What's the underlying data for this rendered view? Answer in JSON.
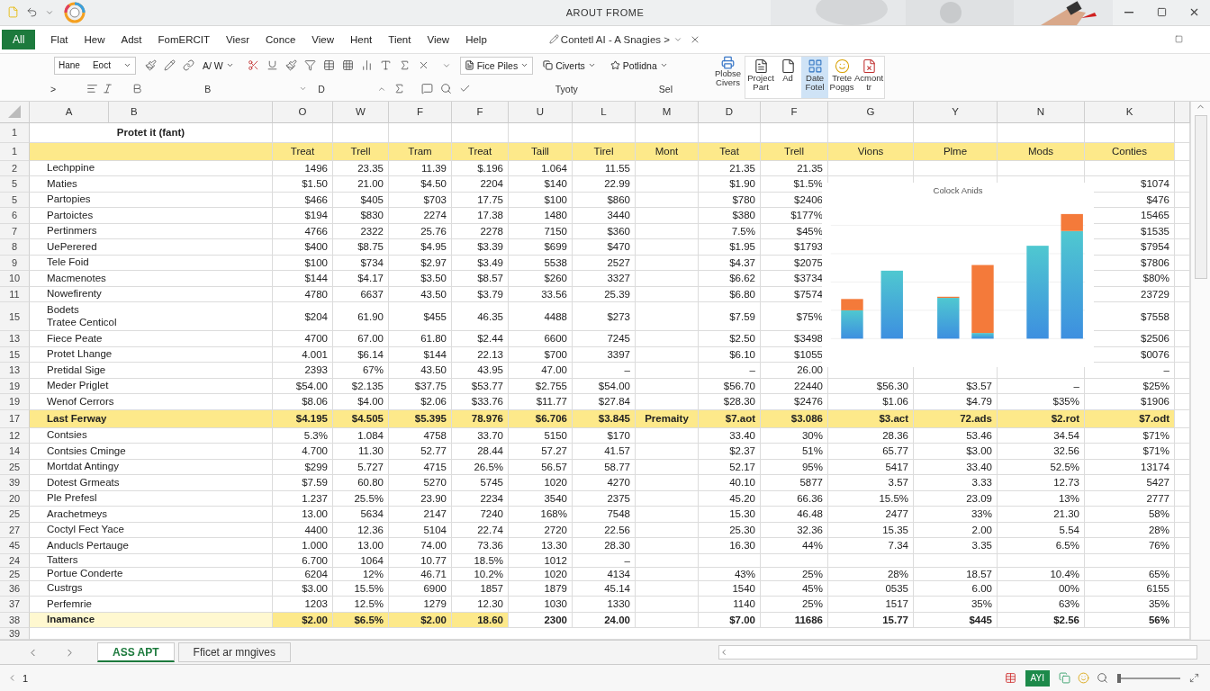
{
  "window": {
    "title": "AROUT FROME"
  },
  "menu": {
    "file_button": "All",
    "tabs": [
      "Flat",
      "Hew",
      "Adst",
      "FomERCIT",
      "Viesr",
      "Conce",
      "View",
      "Hent",
      "Tient",
      "View",
      "Help"
    ],
    "document": "Contetl AI - A Snagies >"
  },
  "ribbon": {
    "font": "Hane",
    "size": "Eoct",
    "style": "A/ W",
    "dropdowns": [
      "Fice Piles",
      "Civerts",
      "Potlidna"
    ],
    "side_button": [
      "Plobse",
      "Civers"
    ],
    "large_buttons": [
      {
        "lines": [
          "Project",
          "Part"
        ],
        "selected": false
      },
      {
        "lines": [
          "Ad"
        ],
        "selected": false
      },
      {
        "lines": [
          "Date",
          "Fotel"
        ],
        "selected": true
      },
      {
        "lines": [
          "Trete",
          "Poggs"
        ],
        "selected": false
      },
      {
        "lines": [
          "Acmont",
          "tr"
        ],
        "selected": false
      }
    ],
    "row2": [
      ">",
      "B",
      "D"
    ],
    "group_label": "Tyoty",
    "group_label_2": "Sel"
  },
  "columns": [
    "A",
    "B",
    "O",
    "W",
    "F",
    "F",
    "U",
    "L",
    "M",
    "D",
    "F",
    "G",
    "Y",
    "N",
    "K"
  ],
  "title_row": {
    "number": "1",
    "text": "Protet it (fant)"
  },
  "rows": [
    {
      "number": "1",
      "kind": "header",
      "cells": [
        "Treat",
        "Trell",
        "Tram",
        "Treat",
        "Taill",
        "Tirel",
        "Mont",
        "Teat",
        "Trell",
        "Vions",
        "Plme",
        "Mods",
        "Conties"
      ]
    },
    {
      "number": "2",
      "kind": "normal",
      "label": "Lechppine",
      "cells": [
        "1496",
        "23.35",
        "11.39",
        "$.196",
        "1.064",
        "11.55",
        null,
        "21.35",
        "21.35",
        null,
        null,
        null,
        null
      ]
    },
    {
      "number": "5",
      "kind": "normal",
      "label": "Maties",
      "cells": [
        "$1.50",
        "21.00",
        "$4.50",
        "2204",
        "$140",
        "22.99",
        null,
        "$1.90",
        "$1.5%",
        null,
        null,
        null,
        "$1074"
      ]
    },
    {
      "number": "5",
      "kind": "normal",
      "label": "Partopies",
      "cells": [
        "$466",
        "$405",
        "$703",
        "17.75",
        "$100",
        "$860",
        null,
        "$780",
        "$2406",
        null,
        null,
        null,
        "$476"
      ]
    },
    {
      "number": "6",
      "kind": "normal",
      "label": "Partoictes",
      "cells": [
        "$194",
        "$830",
        "2274",
        "17.38",
        "1480",
        "3440",
        null,
        "$380",
        "$177%",
        null,
        null,
        null,
        "15465"
      ]
    },
    {
      "number": "7",
      "kind": "normal",
      "label": "Pertinmers",
      "cells": [
        "4766",
        "2322",
        "25.76",
        "2278",
        "7150",
        "$360",
        null,
        "7.5%",
        "$45%",
        null,
        null,
        null,
        "$1535"
      ]
    },
    {
      "number": "8",
      "kind": "normal",
      "label": "UePerered",
      "cells": [
        "$400",
        "$8.75",
        "$4.95",
        "$3.39",
        "$699",
        "$470",
        null,
        "$1.95",
        "$1793",
        null,
        null,
        null,
        "$7954"
      ]
    },
    {
      "number": "9",
      "kind": "normal",
      "label": "Tele Foid",
      "cells": [
        "$100",
        "$734",
        "$2.97",
        "$3.49",
        "5538",
        "2527",
        null,
        "$4.37",
        "$2075",
        null,
        null,
        null,
        "$7806"
      ]
    },
    {
      "number": "10",
      "kind": "normal",
      "label": "Macmenotes",
      "cells": [
        "$144",
        "$4.17",
        "$3.50",
        "$8.57",
        "$260",
        "3327",
        null,
        "$6.62",
        "$3734",
        null,
        null,
        null,
        "$80%"
      ]
    },
    {
      "number": "11",
      "kind": "normal",
      "label": "Nowefirenty",
      "cells": [
        "4780",
        "6637",
        "43.50",
        "$3.79",
        "33.56",
        "25.39",
        null,
        "$6.80",
        "$7574",
        null,
        null,
        null,
        "23729"
      ]
    },
    {
      "number": "15",
      "kind": "normal",
      "note": "Bodets",
      "label": "Tratee Centicol",
      "cells": [
        "$204",
        "61.90",
        "$455",
        "46.35",
        "4488",
        "$273",
        null,
        "$7.59",
        "$75%",
        null,
        null,
        null,
        "$7558"
      ]
    },
    {
      "number": "13",
      "kind": "normal",
      "label": "Fiece Peate",
      "cells": [
        "4700",
        "67.00",
        "61.80",
        "$2.44",
        "6600",
        "7245",
        null,
        "$2.50",
        "$3498",
        null,
        null,
        null,
        "$2506"
      ]
    },
    {
      "number": "15",
      "kind": "normal",
      "label": "Protet Lhange",
      "cells": [
        "4.001",
        "$6.14",
        "$144",
        "22.13",
        "$700",
        "3397",
        null,
        "$6.10",
        "$1055",
        null,
        null,
        null,
        "$0076"
      ]
    },
    {
      "number": "13",
      "kind": "normal",
      "label": "Pretidal Sige",
      "cells": [
        "2393",
        "67%",
        "43.50",
        "43.95",
        "47.00",
        "–",
        null,
        "–",
        "26.00",
        null,
        null,
        null,
        "–"
      ]
    },
    {
      "number": "19",
      "kind": "normal",
      "label": "Meder Priglet",
      "cells": [
        "$54.00",
        "$2.135",
        "$37.75",
        "$53.77",
        "$2.755",
        "$54.00",
        null,
        "$56.70",
        "22440",
        "$56.30",
        "$3.57",
        "–",
        "$25%"
      ]
    },
    {
      "number": "19",
      "kind": "normal",
      "label": "Wenof Cerrors",
      "cells": [
        "$8.06",
        "$4.00",
        "$2.06",
        "$33.76",
        "$11.77",
        "$27.84",
        null,
        "$28.30",
        "$2476",
        "$1.06",
        "$4.79",
        "$35%",
        "$1906"
      ]
    },
    {
      "number": "17",
      "kind": "total",
      "label": "Last Ferway",
      "cells": [
        "$4.195",
        "$4.505",
        "$5.395",
        "78.976",
        "$6.706",
        "$3.845",
        "Premaity",
        "$7.aot",
        "$3.086",
        "$3.act",
        "72.ads",
        "$2.rot",
        "$7.odt"
      ]
    },
    {
      "number": "12",
      "kind": "normal",
      "label": "Contsies",
      "cells": [
        "5.3%",
        "1.084",
        "4758",
        "33.70",
        "5150",
        "$170",
        null,
        "33.40",
        "30%",
        "28.36",
        "53.46",
        "34.54",
        "$71%"
      ]
    },
    {
      "number": "14",
      "kind": "normal",
      "label": "Contsies Cminge",
      "cells": [
        "4.700",
        "11.30",
        "52.77",
        "28.44",
        "57.27",
        "41.57",
        null,
        "$2.37",
        "51%",
        "65.77",
        "$3.00",
        "32.56",
        "$71%"
      ]
    },
    {
      "number": "25",
      "kind": "normal",
      "label": "Mortdat Antingy",
      "cells": [
        "$299",
        "5.727",
        "4715",
        "26.5%",
        "56.57",
        "58.77",
        null,
        "52.17",
        "95%",
        "5417",
        "33.40",
        "52.5%",
        "13174"
      ]
    },
    {
      "number": "39",
      "kind": "normal",
      "label": "Dotest Grmeats",
      "cells": [
        "$7.59",
        "60.80",
        "5270",
        "5745",
        "1020",
        "4270",
        null,
        "40.10",
        "5877",
        "3.57",
        "3.33",
        "12.73",
        "5427"
      ]
    },
    {
      "number": "20",
      "kind": "normal",
      "label": "Ple Prefesl",
      "cells": [
        "1.237",
        "25.5%",
        "23.90",
        "2234",
        "3540",
        "2375",
        null,
        "45.20",
        "66.36",
        "15.5%",
        "23.09",
        "13%",
        "2777"
      ]
    },
    {
      "number": "25",
      "kind": "normal",
      "label": "Arachetmeys",
      "cells": [
        "13.00",
        "5634",
        "2147",
        "7240",
        "168%",
        "7548",
        null,
        "15.30",
        "46.48",
        "2477",
        "33%",
        "21.30",
        "58%"
      ]
    },
    {
      "number": "27",
      "kind": "normal",
      "label": "Coctyl Fect Yace",
      "cells": [
        "4400",
        "12.36",
        "5104",
        "22.74",
        "2720",
        "22.56",
        null,
        "25.30",
        "32.36",
        "15.35",
        "2.00",
        "5.54",
        "28%"
      ]
    },
    {
      "number": "45",
      "kind": "normal",
      "label": "Anducls Pertauge",
      "cells": [
        "1.000",
        "13.00",
        "74.00",
        "73.36",
        "13.30",
        "28.30",
        null,
        "16.30",
        "44%",
        "7.34",
        "3.35",
        "6.5%",
        "76%"
      ]
    },
    {
      "number": "24",
      "kind": "compact",
      "label": "Tatters",
      "cells": [
        "6.700",
        "1064",
        "10.77",
        "18.5%",
        "1012",
        "–",
        null,
        null,
        null,
        null,
        null,
        null,
        null
      ]
    },
    {
      "number": "25",
      "kind": "compact",
      "label": "Portue Conderte",
      "cells": [
        "6204",
        "12%",
        "46.71",
        "10.2%",
        "1020",
        "4134",
        null,
        "43%",
        "25%",
        "28%",
        "18.57",
        "10.4%",
        "65%"
      ]
    },
    {
      "number": "36",
      "kind": "normal",
      "label": "Custrgs",
      "cells": [
        "$3.00",
        "15.5%",
        "6900",
        "1857",
        "1879",
        "45.14",
        null,
        "1540",
        "45%",
        "0535",
        "6.00",
        "00%",
        "6155"
      ]
    },
    {
      "number": "37",
      "kind": "normal",
      "label": "Perfemrie",
      "cells": [
        "1203",
        "12.5%",
        "1279",
        "12.30",
        "1030",
        "1330",
        null,
        "1140",
        "25%",
        "1517",
        "35%",
        "63%",
        "35%"
      ]
    },
    {
      "number": "38",
      "kind": "partial",
      "label": "Inamance",
      "cells": [
        "$2.00",
        "$6.5%",
        "$2.00",
        "18.60",
        "2300",
        "24.00",
        null,
        "$7.00",
        "11686",
        "15.77",
        "$445",
        "$2.56",
        "56%"
      ]
    },
    {
      "number": "39",
      "kind": "blank"
    }
  ],
  "chart": {
    "title": "Colock Anids"
  },
  "sheet_tabs": [
    {
      "label": "ASS APT",
      "selected": true
    },
    {
      "label": "Fficet ar mngives",
      "selected": false
    }
  ],
  "status_bar": {
    "page": "1",
    "view_button": "AYI",
    "zoom": {
      "level": 0.03
    }
  }
}
